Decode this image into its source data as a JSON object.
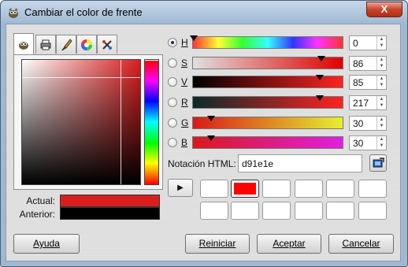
{
  "window": {
    "title": "Cambiar el color de frente",
    "close_label": "X"
  },
  "tabs": [
    {
      "icon": "gimp-icon"
    },
    {
      "icon": "printer-icon"
    },
    {
      "icon": "brush-icon"
    },
    {
      "icon": "color-wheel-icon"
    },
    {
      "icon": "watercolor-icon"
    }
  ],
  "comparison": {
    "actual_label": "Actual:",
    "anterior_label": "Anterior:",
    "actual_color": "#d91e1e",
    "anterior_color": "#000000"
  },
  "sliders": [
    {
      "key": "H",
      "value": "0",
      "checked": true,
      "level": 0.0
    },
    {
      "key": "S",
      "value": "86",
      "checked": false,
      "level": 0.86
    },
    {
      "key": "V",
      "value": "85",
      "checked": false,
      "level": 0.85
    },
    {
      "key": "R",
      "value": "217",
      "checked": false,
      "level": 0.851
    },
    {
      "key": "G",
      "value": "30",
      "checked": false,
      "level": 0.118
    },
    {
      "key": "B",
      "value": "30",
      "checked": false,
      "level": 0.118
    }
  ],
  "html_notation": {
    "label": "Notación HTML:",
    "value": "d91e1e"
  },
  "history": {
    "arrow": "▶",
    "selected_color": "#ff0000"
  },
  "buttons": {
    "help": "Ayuda",
    "reset": "Reiniciar",
    "accept": "Aceptar",
    "cancel": "Cancelar"
  },
  "colors": {
    "current": "#d91e1e",
    "previous": "#000000"
  }
}
